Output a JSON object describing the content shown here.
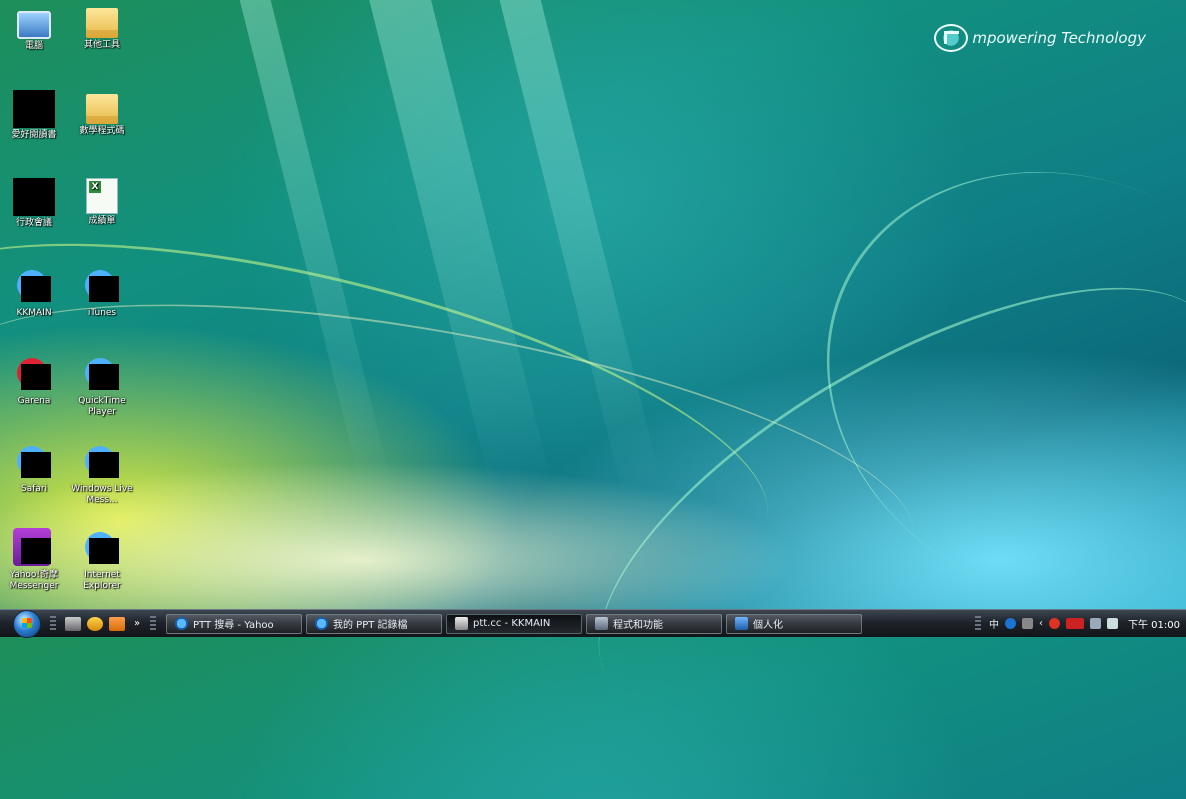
{
  "brand": {
    "text": "mpowering Technology"
  },
  "desktop_icons": [
    {
      "label": "電腦"
    },
    {
      "label": "其他工具"
    },
    {
      "label": "愛好閱讀書"
    },
    {
      "label": "數學程式碼"
    },
    {
      "label": "行政會議"
    },
    {
      "label": "成績單"
    },
    {
      "label": "KKMAIN"
    },
    {
      "label": "iTunes"
    },
    {
      "label": "Garena"
    },
    {
      "label": "QuickTime Player"
    },
    {
      "label": "Safari"
    },
    {
      "label": "Windows Live Mess..."
    },
    {
      "label": "Yahoo!奇摩 Messenger"
    },
    {
      "label": "Internet Explorer"
    }
  ],
  "taskbar": {
    "overflow_glyph": "»",
    "tasks": [
      {
        "label": "PTT 搜尋 - Yahoo",
        "icon": "ie-icon"
      },
      {
        "label": "我的 PPT 記錄檔",
        "icon": "ie-icon"
      },
      {
        "label": "ptt.cc - KKMAIN",
        "icon": "ptt-icon"
      },
      {
        "label": "程式和功能",
        "icon": "programs-icon"
      },
      {
        "label": "個人化",
        "icon": "personalize-icon"
      }
    ],
    "tray": {
      "text_a": "中",
      "clock": "下午 01:00"
    }
  },
  "colors": {
    "accent": "#12907f"
  }
}
